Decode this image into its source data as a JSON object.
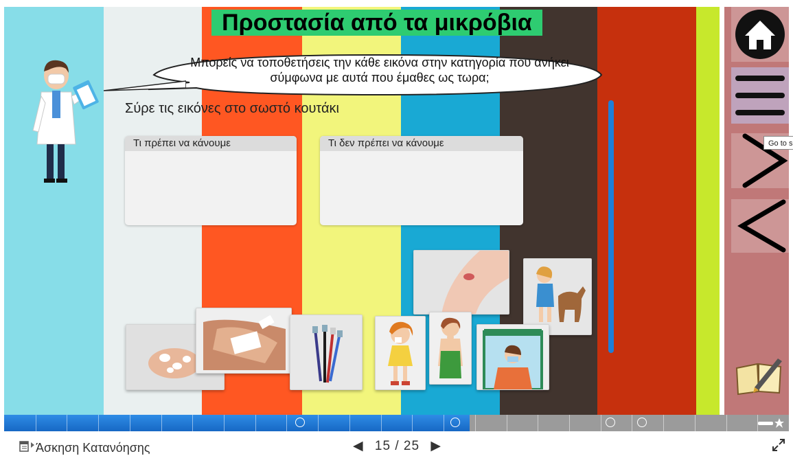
{
  "lesson": {
    "title": "Προστασία από τα μικρόβια",
    "speech": "Μπορείς να τοποθετήσεις την κάθε εικόνα στην κατηγορία που ανήκει σύμφωνα με αυτά που έμαθες ως τωρα;",
    "instruction": "Σύρε τις εικόνες στο σωστό κουτάκι"
  },
  "dropzones": [
    {
      "label": "Τι πρέπει να κάνουμε"
    },
    {
      "label": "Τι δεν πρέπει να κάνουμε"
    }
  ],
  "cards": [
    {
      "name": "handwashing-card",
      "icon": "hand-washing"
    },
    {
      "name": "bandage-card",
      "icon": "applying-bandage"
    },
    {
      "name": "toothbrushes-card",
      "icon": "toothbrushes"
    },
    {
      "name": "wound-card",
      "icon": "scraped-knee"
    },
    {
      "name": "girl-sneezing-card",
      "icon": "sneezing-girl"
    },
    {
      "name": "woman-coughing-card",
      "icon": "coughing-woman"
    },
    {
      "name": "child-dog-card",
      "icon": "child-and-dog"
    },
    {
      "name": "window-mask-card",
      "icon": "masked-woman-window"
    }
  ],
  "nav": {
    "tooltip": "Go to s",
    "home_icon": "home-icon",
    "menu_icon": "menu-icon",
    "next_icon": "chevron-right-icon",
    "prev_icon": "chevron-left-icon",
    "notebook_icon": "notebook-pen-icon"
  },
  "progress": {
    "current_slide": 15,
    "total_slides": 25
  },
  "footer": {
    "section_title": "Άσκηση Κατανόησης",
    "page_current": "15",
    "page_separator": "/",
    "page_total": "25"
  },
  "colors": {
    "title_bg": "#2ecc71",
    "nav_panel": "#c07878",
    "progress_blue": "#1e7fd9",
    "stripes": [
      "#87dde8",
      "#eaf0f0",
      "#ff5722",
      "#f2f57c",
      "#19a9d4",
      "#41342e",
      "#c6300d",
      "#c7e82c"
    ]
  }
}
